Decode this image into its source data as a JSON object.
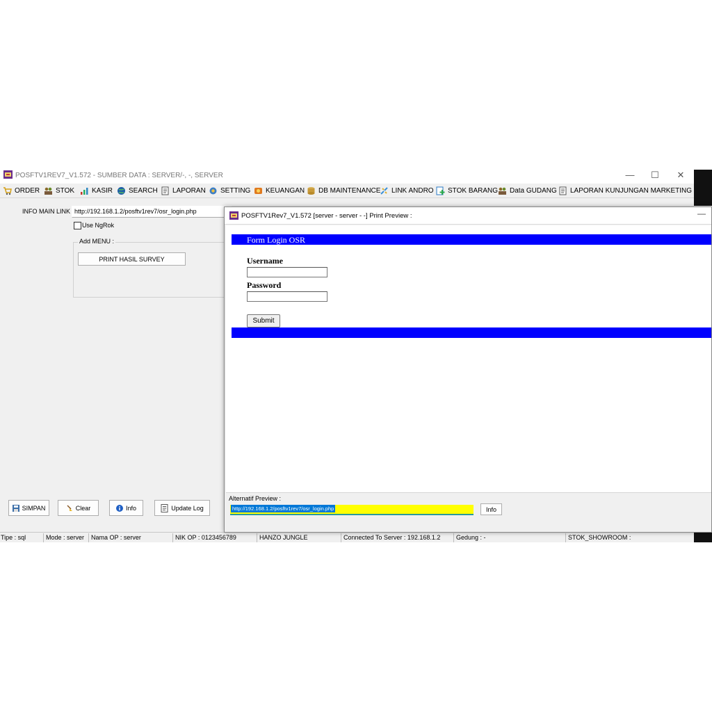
{
  "main_window": {
    "title": "POSFTV1REV7_V1.572 - SUMBER DATA : SERVER/-, -, SERVER",
    "controls": {
      "minimize": "—",
      "maximize": "☐",
      "close": "✕"
    }
  },
  "menu": [
    {
      "label": "ORDER",
      "icon": "cart-icon"
    },
    {
      "label": "STOK",
      "icon": "people-icon"
    },
    {
      "label": "KASIR",
      "icon": "chart-icon"
    },
    {
      "label": "SEARCH",
      "icon": "globe-icon"
    },
    {
      "label": "LAPORAN",
      "icon": "report-icon"
    },
    {
      "label": "SETTING",
      "icon": "gear-icon"
    },
    {
      "label": "KEUANGAN",
      "icon": "money-icon"
    },
    {
      "label": "DB MAINTENANCE",
      "icon": "database-icon"
    },
    {
      "label": "LINK ANDRO",
      "icon": "link-icon"
    },
    {
      "label": "STOK BARANG",
      "icon": "add-icon"
    },
    {
      "label": "Data GUDANG",
      "icon": "people-icon"
    },
    {
      "label": "LAPORAN KUNJUNGAN MARKETING",
      "icon": "report-icon"
    }
  ],
  "link_panel": {
    "info_label": "INFO MAIN LINK",
    "url_value": "http://192.168.1.2/posftv1rev7/osr_login.php",
    "use_ngrok_label": "Use NgRok",
    "add_menu_label": "Add MENU :",
    "print_button": "PRINT HASIL SURVEY"
  },
  "bottom_buttons": {
    "simpan": "SIMPAN",
    "clear": "Clear",
    "info": "Info",
    "update_log": "Update Log"
  },
  "status": {
    "tipe": "Tipe : sql",
    "mode": "Mode : server",
    "nama_op": "Nama OP : server",
    "nik_op": "NIK OP : 0123456789",
    "hanzo": "HANZO JUNGLE",
    "connected": "Connected To Server : 192.168.1.2",
    "gedung": "Gedung : -",
    "stok": "STOK_SHOWROOM :"
  },
  "preview": {
    "title": "POSFTV1Rev7_V1.572 [server - server - -] Print Preview :",
    "minimize": "—",
    "form_title": "Form Login OSR",
    "username_label": "Username",
    "password_label": "Password",
    "submit_label": "Submit",
    "alt_label": "Alternatif Preview :",
    "alt_url": "http://192.168.1.2/posftv1rev7/osr_login.php",
    "alt_info_button": "Info",
    "colors": {
      "banner": "#0000ff",
      "alt_field": "#ffff00",
      "selection": "#0078d7"
    }
  }
}
